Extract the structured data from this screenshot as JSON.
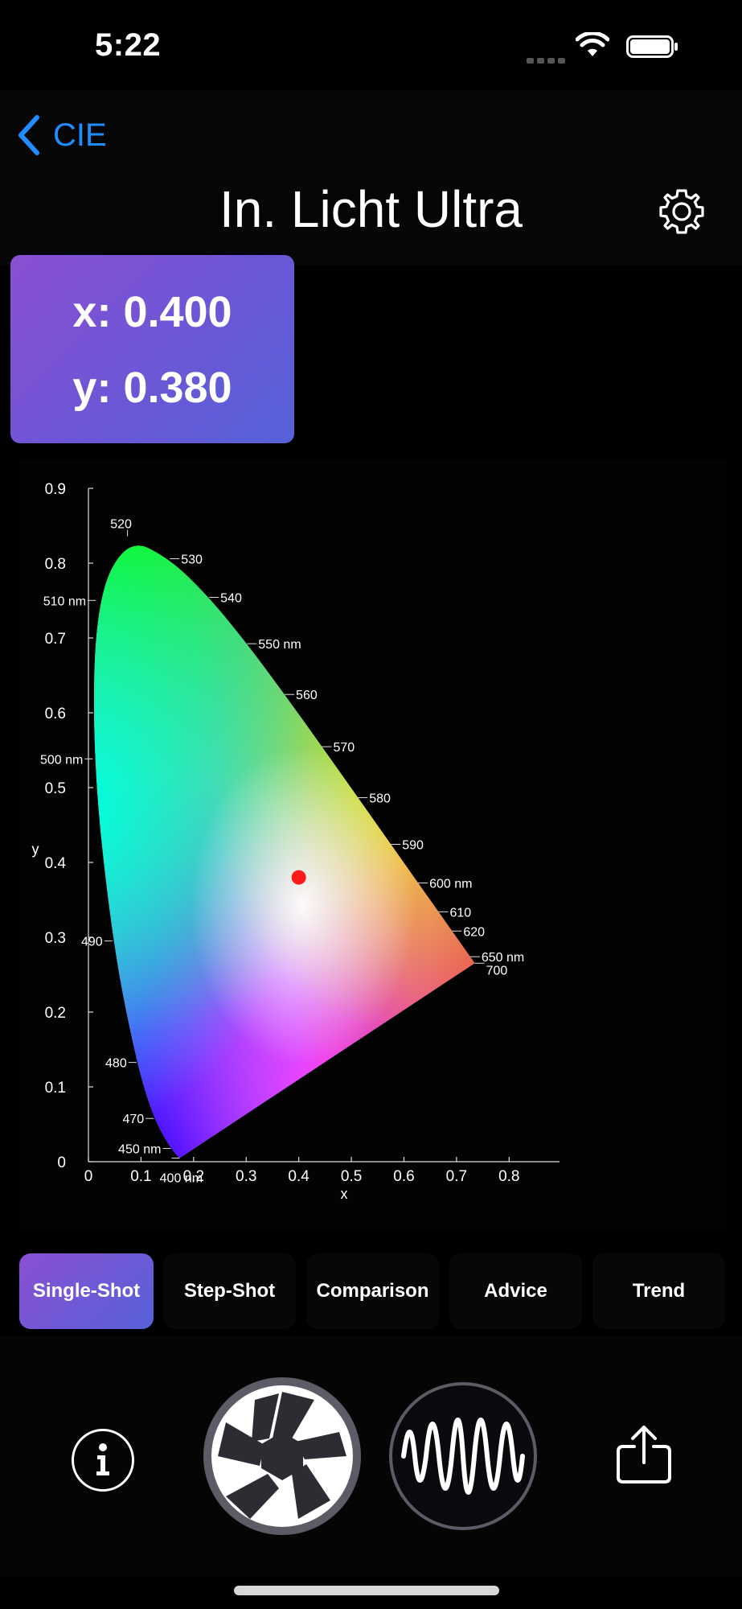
{
  "status_bar": {
    "time": "5:22"
  },
  "nav": {
    "back_label": "CIE",
    "title": "In. Licht Ultra"
  },
  "coordinates": {
    "x_text": "x: 0.400",
    "y_text": "y: 0.380"
  },
  "chart_data": {
    "type": "scatter",
    "title": "",
    "xlabel": "x",
    "ylabel": "y",
    "xlim": [
      0,
      0.85
    ],
    "ylim": [
      0,
      0.9
    ],
    "x_ticks": [
      "0",
      "0.1",
      "0.2",
      "0.3",
      "0.4",
      "0.5",
      "0.6",
      "0.7",
      "0.8"
    ],
    "y_ticks": [
      "0",
      "0.1",
      "0.2",
      "0.3",
      "0.4",
      "0.5",
      "0.6",
      "0.7",
      "0.8",
      "0.9"
    ],
    "measured_point": {
      "x": 0.4,
      "y": 0.38,
      "color": "#ff1a1a"
    },
    "wavelength_labels": [
      {
        "label": "400 nm",
        "x": 0.1733,
        "y": 0.0048
      },
      {
        "label": "450 nm",
        "x": 0.1566,
        "y": 0.0177
      },
      {
        "label": "470",
        "x": 0.1241,
        "y": 0.0578
      },
      {
        "label": "480",
        "x": 0.0913,
        "y": 0.1327
      },
      {
        "label": "490",
        "x": 0.0454,
        "y": 0.295
      },
      {
        "label": "500 nm",
        "x": 0.0082,
        "y": 0.5384
      },
      {
        "label": "510 nm",
        "x": 0.0139,
        "y": 0.7502
      },
      {
        "label": "520",
        "x": 0.0743,
        "y": 0.8338
      },
      {
        "label": "530",
        "x": 0.1547,
        "y": 0.8059
      },
      {
        "label": "540",
        "x": 0.2296,
        "y": 0.7543
      },
      {
        "label": "550 nm",
        "x": 0.3016,
        "y": 0.6923
      },
      {
        "label": "560",
        "x": 0.3731,
        "y": 0.6245
      },
      {
        "label": "570",
        "x": 0.4441,
        "y": 0.5547
      },
      {
        "label": "580",
        "x": 0.5125,
        "y": 0.4866
      },
      {
        "label": "590",
        "x": 0.5752,
        "y": 0.4242
      },
      {
        "label": "600 nm",
        "x": 0.627,
        "y": 0.3725
      },
      {
        "label": "610",
        "x": 0.6658,
        "y": 0.334
      },
      {
        "label": "620",
        "x": 0.6915,
        "y": 0.3083
      },
      {
        "label": "650 nm",
        "x": 0.726,
        "y": 0.274
      },
      {
        "label": "700",
        "x": 0.7347,
        "y": 0.2653
      }
    ]
  },
  "tabs": [
    {
      "label": "Single-Shot",
      "active": true
    },
    {
      "label": "Step-Shot",
      "active": false
    },
    {
      "label": "Comparison",
      "active": false
    },
    {
      "label": "Advice",
      "active": false
    },
    {
      "label": "Trend",
      "active": false
    }
  ],
  "toolbar": {
    "info_icon": "info-icon",
    "shutter_icon": "camera-shutter-icon",
    "waveform_icon": "waveform-icon",
    "share_icon": "share-icon"
  }
}
